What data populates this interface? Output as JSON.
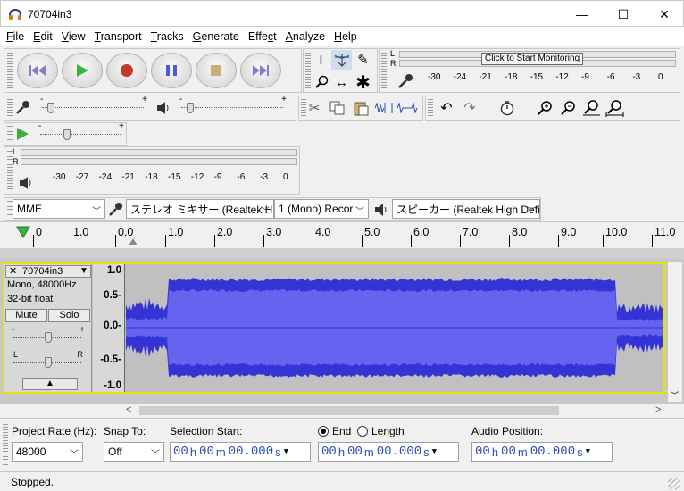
{
  "window": {
    "title": "70704in3",
    "minimize": "—",
    "maximize": "☐",
    "close": "✕"
  },
  "menu": [
    "File",
    "Edit",
    "View",
    "Transport",
    "Tracks",
    "Generate",
    "Effect",
    "Analyze",
    "Help"
  ],
  "menu_accel": [
    "F",
    "E",
    "V",
    "T",
    "T",
    "G",
    "c",
    "A",
    "H"
  ],
  "meter": {
    "click_label": "Click to Start Monitoring",
    "rec_scale": [
      "-30",
      "-24",
      "-21",
      "-18",
      "-15",
      "-12",
      "-9",
      "-6",
      "-3",
      "0"
    ],
    "play_scale": [
      "-30",
      "-27",
      "-24",
      "-21",
      "-18",
      "-15",
      "-12",
      "-9",
      "-6",
      "-3",
      "0"
    ],
    "L": "L",
    "R": "R"
  },
  "devices": {
    "host": "MME",
    "rec_device": "ステレオ ミキサー (Realtek Hig",
    "channels": "1 (Mono) Recor",
    "play_device": "スピーカー (Realtek High Defi"
  },
  "ruler": [
    "0",
    "1.0",
    "0.0",
    "1.0",
    "2.0",
    "3.0",
    "4.0",
    "5.0",
    "6.0",
    "7.0",
    "8.0",
    "9.0",
    "10.0",
    "11.0"
  ],
  "track": {
    "name": "70704in3",
    "info1": "Mono, 48000Hz",
    "info2": "32-bit float",
    "mute": "Mute",
    "solo": "Solo",
    "gain_minus": "-",
    "gain_plus": "+",
    "pan_left": "L",
    "pan_right": "R",
    "scale": [
      "1.0",
      "0.5-",
      "0.0-",
      "-0.5-",
      "-1.0"
    ]
  },
  "selection": {
    "project_rate_label": "Project Rate (Hz):",
    "project_rate": "48000",
    "snap_label": "Snap To:",
    "snap_value": "Off",
    "sel_start_label": "Selection Start:",
    "end_label": "End",
    "length_label": "Length",
    "audio_pos_label": "Audio Position:",
    "time_h": "00",
    "time_m": "00",
    "time_s": "00.000",
    "unit_h": "h",
    "unit_m": "m",
    "unit_s": "s"
  },
  "status": "Stopped.",
  "colors": {
    "wave": "#3434d6",
    "wave_rms": "#6464f0",
    "track_bg": "#c0c0c0",
    "selected_border": "#e5e500"
  }
}
